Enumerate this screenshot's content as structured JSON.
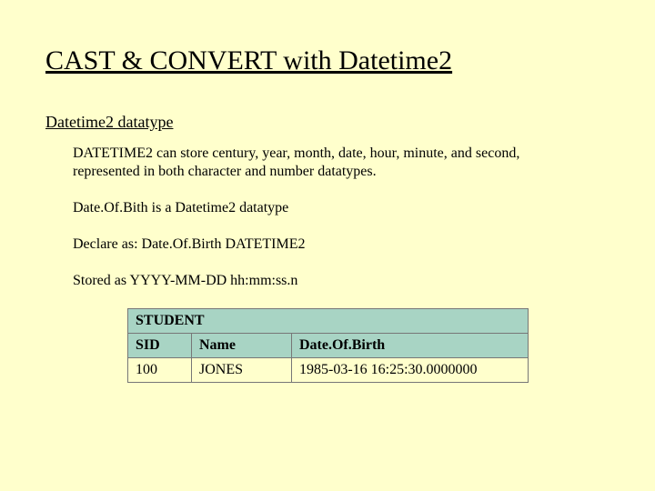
{
  "title": "CAST & CONVERT with Datetime2",
  "subhead": "Datetime2 datatype",
  "paragraphs": {
    "p1": "DATETIME2 can store century, year, month, date, hour, minute, and second, represented in both character and number datatypes.",
    "p2": "Date.Of.Bith is a Datetime2 datatype",
    "p3": "Declare as: Date.Of.Birth DATETIME2",
    "p4": "Stored as YYYY-MM-DD hh:mm:ss.n"
  },
  "table": {
    "caption": "STUDENT",
    "headers": {
      "sid": "SID",
      "name": "Name",
      "dob": "Date.Of.Birth"
    },
    "row": {
      "sid": "100",
      "name": "JONES",
      "dob": "1985-03-16 16:25:30.0000000"
    }
  }
}
